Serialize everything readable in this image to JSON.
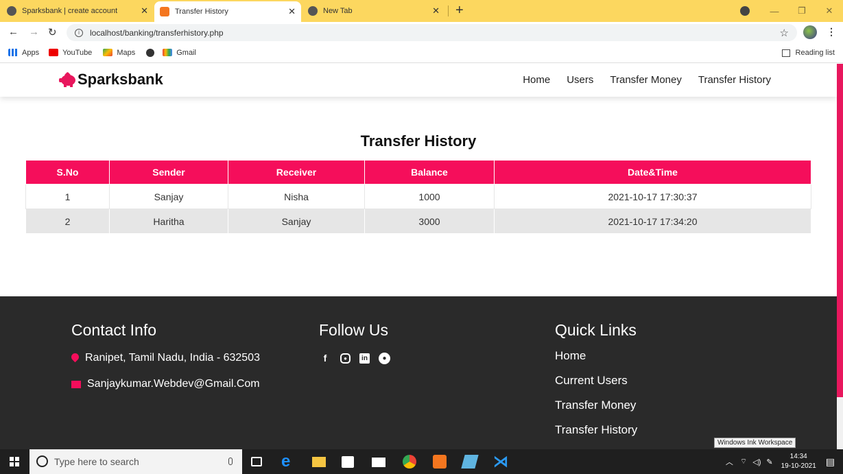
{
  "browser": {
    "tabs": [
      {
        "title": "Sparksbank | create account",
        "active": false
      },
      {
        "title": "Transfer History",
        "active": true
      },
      {
        "title": "New Tab",
        "active": false
      }
    ],
    "url": "localhost/banking/transferhistory.php",
    "bookmarks": [
      "Apps",
      "YouTube",
      "Maps",
      "Gmail"
    ],
    "reading_list": "Reading list"
  },
  "site": {
    "brand": "Sparksbank",
    "nav": [
      "Home",
      "Users",
      "Transfer Money",
      "Transfer History"
    ],
    "accent": "#f50e5b"
  },
  "main": {
    "title": "Transfer History",
    "columns": [
      "S.No",
      "Sender",
      "Receiver",
      "Balance",
      "Date&Time"
    ],
    "rows": [
      [
        "1",
        "Sanjay",
        "Nisha",
        "1000",
        "2021-10-17 17:30:37"
      ],
      [
        "2",
        "Haritha",
        "Sanjay",
        "3000",
        "2021-10-17 17:34:20"
      ]
    ]
  },
  "footer": {
    "contact_title": "Contact Info",
    "address": "Ranipet, Tamil Nadu, India - 632503",
    "email": "Sanjaykumar.Webdev@Gmail.Com",
    "follow_title": "Follow Us",
    "social_icons": [
      "facebook-icon",
      "instagram-icon",
      "linkedin-icon",
      "github-icon"
    ],
    "quick_title": "Quick Links",
    "quick_links": [
      "Home",
      "Current Users",
      "Transfer Money",
      "Transfer History"
    ]
  },
  "tooltip": "Windows Ink Workspace",
  "taskbar": {
    "search_placeholder": "Type here to search",
    "time": "14:34",
    "date": "19-10-2021"
  }
}
